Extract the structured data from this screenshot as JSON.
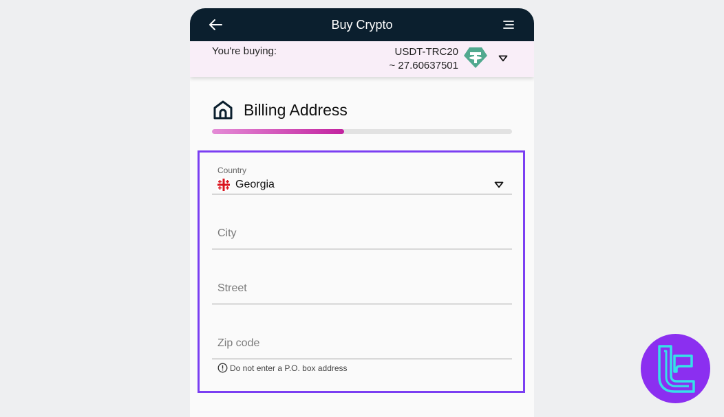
{
  "header": {
    "title": "Buy Crypto",
    "back_icon": "arrow-left-icon",
    "menu_icon": "menu-lines-icon"
  },
  "buying": {
    "label": "You're buying:",
    "asset_name": "USDT-TRC20",
    "asset_amount": "~ 27.60637501",
    "asset_icon": "tether-icon",
    "accent": "#51a98f"
  },
  "section": {
    "title": "Billing Address",
    "icon": "home-icon",
    "progress_fraction": 0.44
  },
  "form": {
    "country": {
      "label": "Country",
      "value": "Georgia",
      "flag_icon": "georgia-flag-icon"
    },
    "city": {
      "placeholder": "City",
      "value": ""
    },
    "street": {
      "placeholder": "Street",
      "value": ""
    },
    "zip": {
      "placeholder": "Zip code",
      "value": ""
    },
    "hint": "Do not enter a P.O. box address"
  },
  "colors": {
    "header_bg": "#0b1f2e",
    "buying_bg": "#f9eef8",
    "highlight_border": "#7b3ff2",
    "progress": "#c2239f",
    "watermark": "#8b2ff0"
  }
}
